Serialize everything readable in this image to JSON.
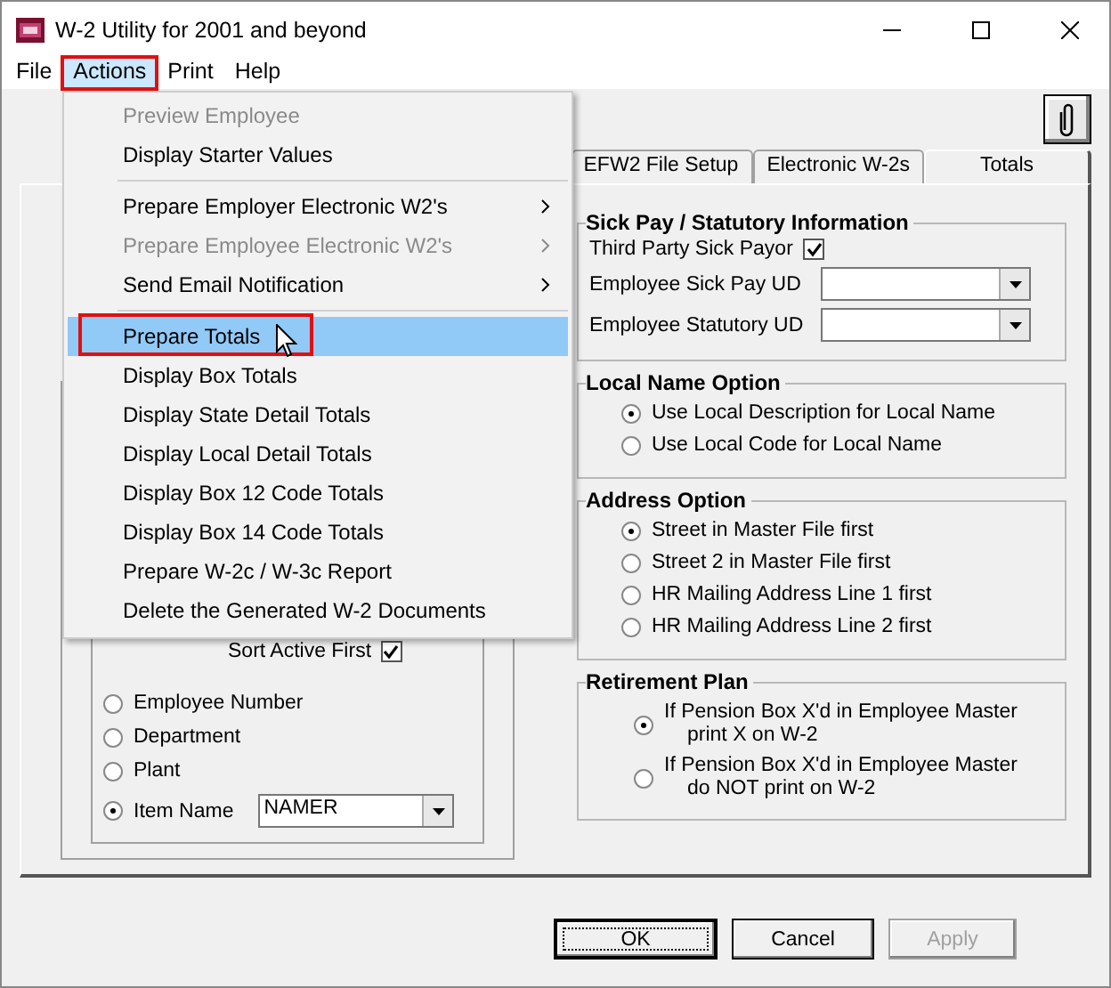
{
  "window": {
    "title": "W-2 Utility for 2001 and beyond"
  },
  "menu_bar": [
    {
      "label": "File",
      "selected": false,
      "annotated": false
    },
    {
      "label": "Actions",
      "selected": true,
      "annotated": true
    },
    {
      "label": "Print",
      "selected": false,
      "annotated": false
    },
    {
      "label": "Help",
      "selected": false,
      "annotated": false
    }
  ],
  "actions_menu": [
    {
      "items": [
        {
          "label": "Preview Employee",
          "disabled": true,
          "submenu": false,
          "selected": false,
          "annotated": false
        },
        {
          "label": "Display Starter Values",
          "disabled": false,
          "submenu": false,
          "selected": false,
          "annotated": false
        }
      ]
    },
    {
      "items": [
        {
          "label": "Prepare Employer Electronic W2's",
          "disabled": false,
          "submenu": true,
          "selected": false,
          "annotated": false
        },
        {
          "label": "Prepare Employee Electronic W2's",
          "disabled": true,
          "submenu": true,
          "selected": false,
          "annotated": false
        },
        {
          "label": "Send Email Notification",
          "disabled": false,
          "submenu": true,
          "selected": false,
          "annotated": false
        }
      ]
    },
    {
      "items": [
        {
          "label": "Prepare Totals",
          "disabled": false,
          "submenu": false,
          "selected": true,
          "annotated": true
        },
        {
          "label": "Display Box Totals",
          "disabled": false,
          "submenu": false,
          "selected": false,
          "annotated": false
        },
        {
          "label": "Display State Detail Totals",
          "disabled": false,
          "submenu": false,
          "selected": false,
          "annotated": false
        },
        {
          "label": "Display Local Detail Totals",
          "disabled": false,
          "submenu": false,
          "selected": false,
          "annotated": false
        },
        {
          "label": "Display Box 12 Code Totals",
          "disabled": false,
          "submenu": false,
          "selected": false,
          "annotated": false
        },
        {
          "label": "Display Box 14 Code Totals",
          "disabled": false,
          "submenu": false,
          "selected": false,
          "annotated": false
        },
        {
          "label": "Prepare W-2c / W-3c Report",
          "disabled": false,
          "submenu": false,
          "selected": false,
          "annotated": false
        },
        {
          "label": "Delete the Generated W-2 Documents",
          "disabled": false,
          "submenu": false,
          "selected": false,
          "annotated": false
        }
      ]
    }
  ],
  "tabs": [
    {
      "label": "EFW2 File Setup",
      "selected": false
    },
    {
      "label": "Electronic W-2s",
      "selected": false
    },
    {
      "label": "Totals",
      "selected": true
    }
  ],
  "sort": {
    "active_first": {
      "label": "Sort Active First",
      "checked": true
    },
    "options": [
      {
        "label": "Employee Number",
        "selected": false
      },
      {
        "label": "Department",
        "selected": false
      },
      {
        "label": "Plant",
        "selected": false
      },
      {
        "label": "Item Name",
        "selected": true
      }
    ],
    "item_name_value": "NAMER"
  },
  "sick_pay": {
    "title": "Sick Pay / Statutory Information",
    "third_party": {
      "label": "Third Party Sick Payor",
      "checked": true
    },
    "fields": [
      {
        "label": "Employee Sick Pay UD"
      },
      {
        "label": "Employee Statutory UD"
      }
    ]
  },
  "local_name_option": {
    "title": "Local Name Option",
    "options": [
      {
        "label": "Use Local Description for Local Name",
        "selected": true
      },
      {
        "label": "Use Local Code for Local Name",
        "selected": false
      }
    ]
  },
  "address_option": {
    "title": "Address Option",
    "options": [
      {
        "label": "Street in Master File first",
        "selected": true
      },
      {
        "label": "Street 2 in Master File first",
        "selected": false
      },
      {
        "label": "HR Mailing Address Line 1 first",
        "selected": false
      },
      {
        "label": "HR Mailing Address Line 2 first",
        "selected": false
      }
    ]
  },
  "retirement_plan": {
    "title": "Retirement Plan",
    "options": [
      {
        "lines": [
          "If Pension Box X'd in Employee Master",
          "print X on W-2"
        ],
        "selected": true
      },
      {
        "lines": [
          "If Pension Box X'd in Employee Master",
          "do NOT print on W-2"
        ],
        "selected": false
      }
    ]
  },
  "buttons": [
    {
      "label": "OK",
      "disabled": false,
      "focused": true
    },
    {
      "label": "Cancel",
      "disabled": false,
      "focused": false
    },
    {
      "label": "Apply",
      "disabled": true,
      "focused": false
    }
  ]
}
